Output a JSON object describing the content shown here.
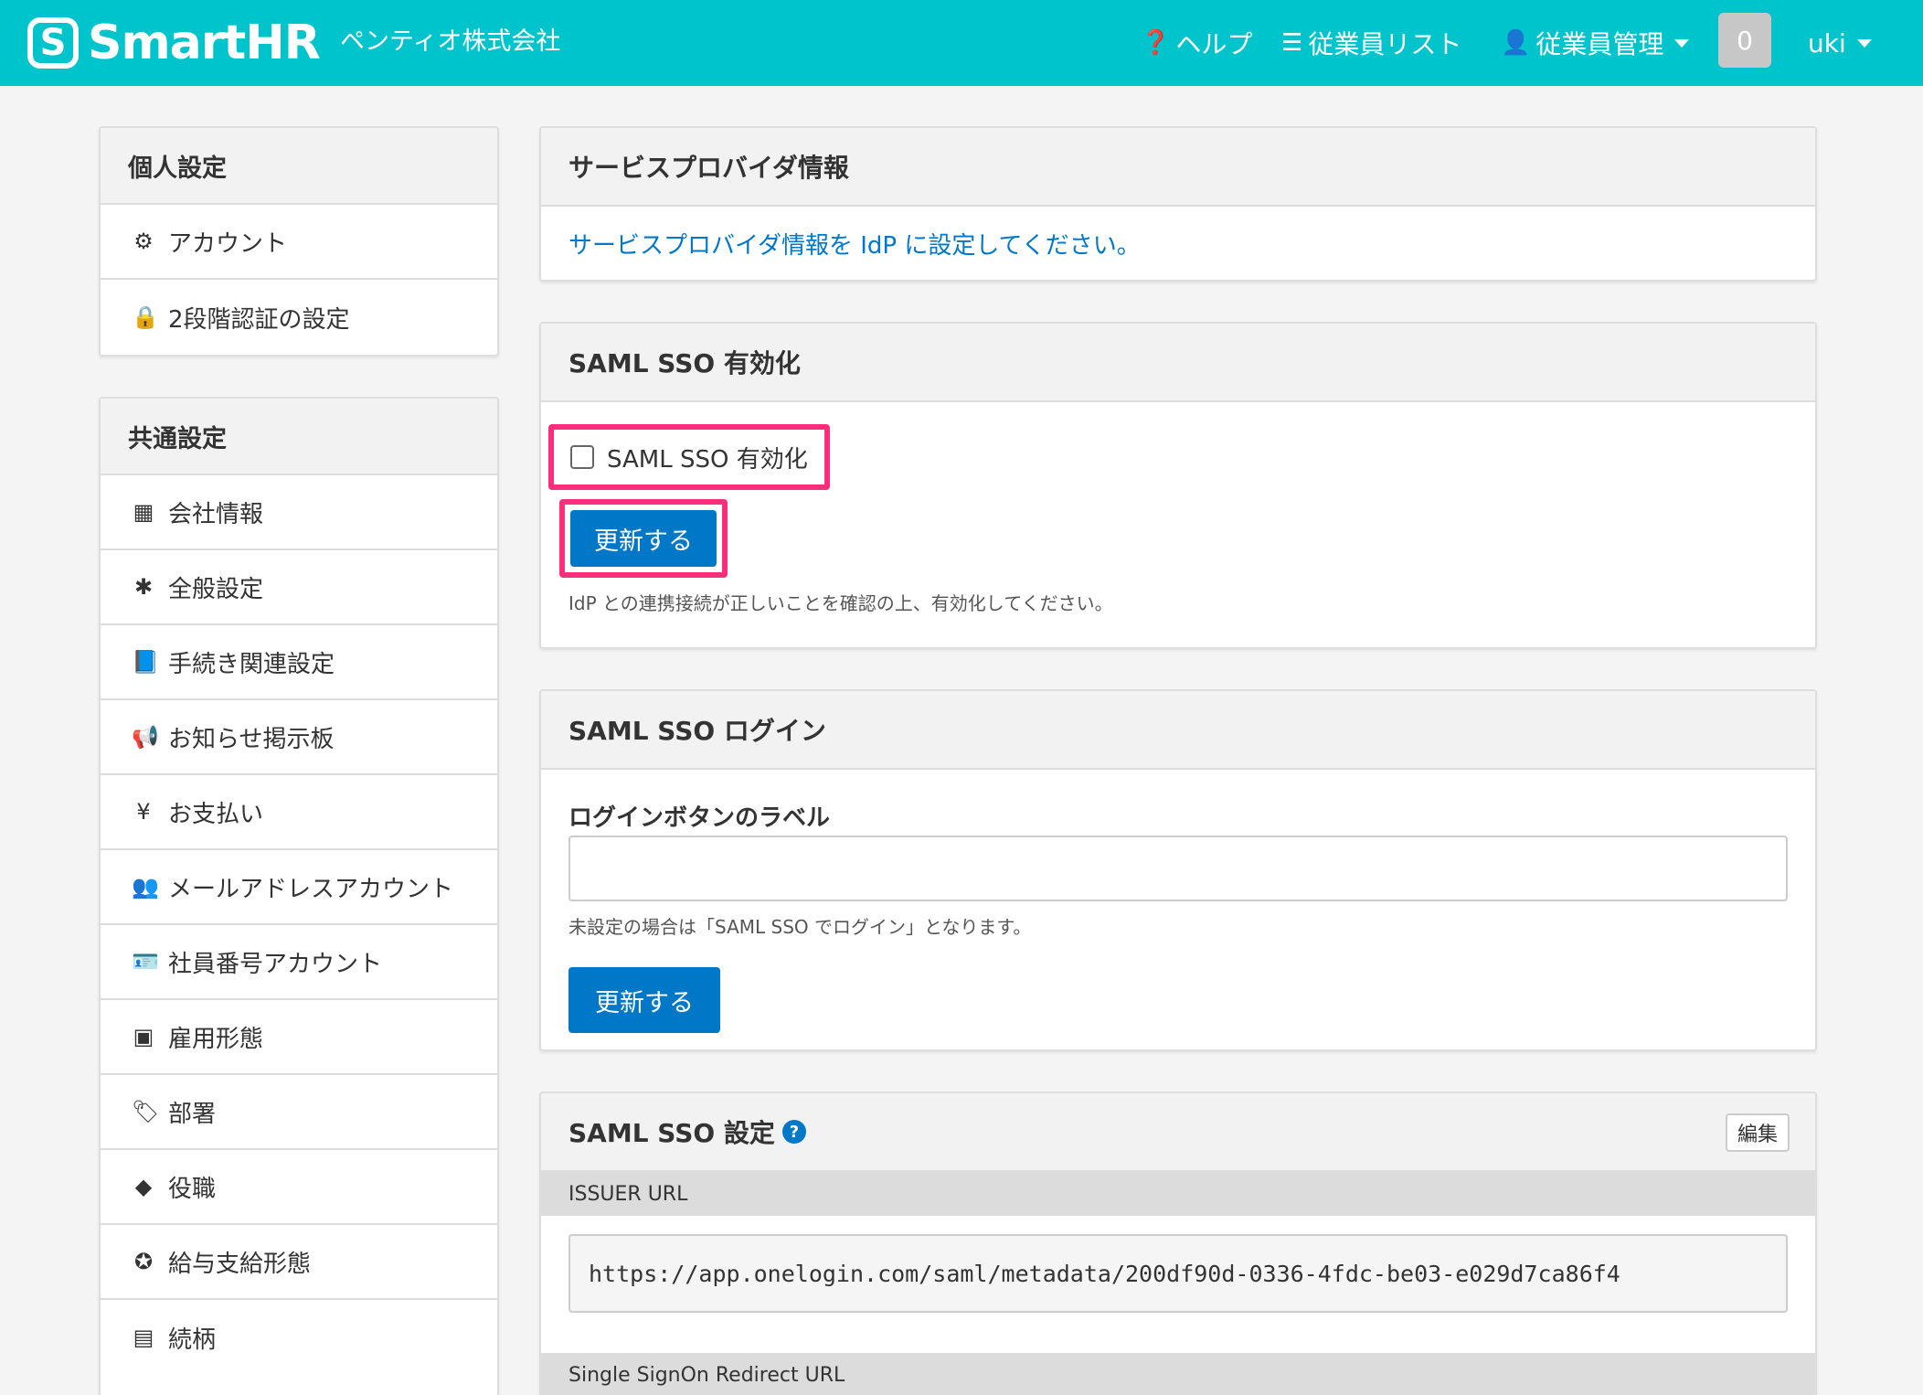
{
  "header": {
    "logo_mark": "S",
    "logo_text": "SmartHR",
    "company": "ペンティオ株式会社",
    "help_label": "ヘルプ",
    "employee_list_label": "従業員リスト",
    "employee_mgmt_label": "従業員管理",
    "notification_count": "0",
    "user_name": "uki",
    "brand_color": "#00c4cc"
  },
  "sidebar": {
    "personal": {
      "title": "個人設定",
      "items": [
        {
          "label": "アカウント",
          "icon": "gear-icon"
        },
        {
          "label": "2段階認証の設定",
          "icon": "lock-icon"
        }
      ]
    },
    "common": {
      "title": "共通設定",
      "items": [
        {
          "label": "会社情報",
          "icon": "building-icon"
        },
        {
          "label": "全般設定",
          "icon": "asterisk-icon"
        },
        {
          "label": "手続き関連設定",
          "icon": "book-icon"
        },
        {
          "label": "お知らせ掲示板",
          "icon": "megaphone-icon"
        },
        {
          "label": "お支払い",
          "icon": "yen-icon"
        },
        {
          "label": "メールアドレスアカウント",
          "icon": "users-icon"
        },
        {
          "label": "社員番号アカウント",
          "icon": "id-card-icon"
        },
        {
          "label": "雇用形態",
          "icon": "badge-icon"
        },
        {
          "label": "部署",
          "icon": "tags-icon"
        },
        {
          "label": "役職",
          "icon": "tag-icon"
        },
        {
          "label": "給与支給形態",
          "icon": "yen-badge-icon"
        },
        {
          "label": "続柄",
          "icon": "portrait-icon"
        }
      ]
    }
  },
  "sp_info": {
    "title": "サービスプロバイダ情報",
    "link_text": "サービスプロバイダ情報を IdP に設定してください。"
  },
  "sso_enable": {
    "title": "SAML SSO 有効化",
    "checkbox_label": "SAML SSO 有効化",
    "update_label": "更新する",
    "help": "IdP との連携接続が正しいことを確認の上、有効化してください。"
  },
  "sso_login": {
    "title": "SAML SSO ログイン",
    "field_label": "ログインボタンのラベル",
    "input_value": "",
    "help": "未設定の場合は「SAML SSO でログイン」となります。",
    "update_label": "更新する"
  },
  "sso_settings": {
    "title": "SAML SSO 設定",
    "help_mark": "?",
    "edit_label": "編集",
    "issuer_label": "ISSUER URL",
    "issuer_url": "https://app.onelogin.com/saml/metadata/200df90d-0336-4fdc-be03-e029d7ca86f4",
    "redirect_label": "Single SignOn Redirect URL"
  },
  "colors": {
    "accent_blue": "#0077c7",
    "highlight": "#ff2d7c"
  }
}
